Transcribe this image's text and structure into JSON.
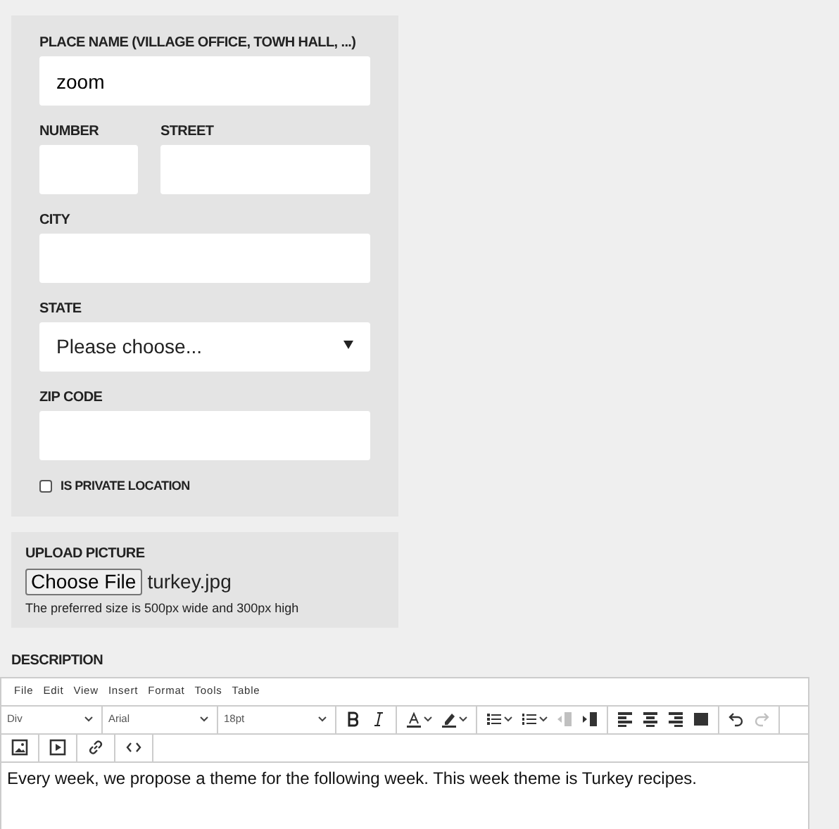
{
  "location": {
    "place_name": {
      "label": "PLACE NAME (VILLAGE OFFICE, TOWH HALL, ...)",
      "value": "zoom"
    },
    "number": {
      "label": "NUMBER"
    },
    "street": {
      "label": "STREET"
    },
    "city": {
      "label": "CITY"
    },
    "state": {
      "label": "STATE",
      "value": "Please choose..."
    },
    "zip": {
      "label": "ZIP CODE"
    },
    "private": {
      "label": "IS PRIVATE LOCATION",
      "checked": false
    }
  },
  "upload": {
    "label": "UPLOAD PICTURE",
    "button": "Choose File",
    "file": "turkey.jpg",
    "hint": "The preferred size is 500px wide and 300px high"
  },
  "description": {
    "label": "DESCRIPTION",
    "menu": [
      "File",
      "Edit",
      "View",
      "Insert",
      "Format",
      "Tools",
      "Table"
    ],
    "dropdowns": [
      "Div",
      "Arial",
      "18pt"
    ],
    "toolbar": [
      [
        {
          "kind": "bold",
          "disabled": false
        },
        {
          "kind": "italic",
          "disabled": false
        }
      ],
      [
        {
          "kind": "text-color",
          "disabled": false,
          "split": true
        },
        {
          "kind": "highlight",
          "disabled": false,
          "split": true
        }
      ],
      [
        {
          "kind": "bullets",
          "disabled": false,
          "split": true
        },
        {
          "kind": "numbers",
          "disabled": false,
          "split": true
        },
        {
          "kind": "outdent",
          "disabled": true
        },
        {
          "kind": "indent",
          "disabled": false
        }
      ],
      [
        {
          "kind": "align-left",
          "disabled": false
        },
        {
          "kind": "align-center",
          "disabled": false
        },
        {
          "kind": "align-right",
          "disabled": false
        },
        {
          "kind": "justify",
          "disabled": false
        }
      ],
      [
        {
          "kind": "undo",
          "disabled": false
        },
        {
          "kind": "redo",
          "disabled": true
        }
      ]
    ],
    "toolbar2": [
      {
        "kind": "image",
        "disabled": false
      },
      {
        "kind": "media",
        "disabled": false
      },
      {
        "kind": "link",
        "disabled": false
      },
      {
        "kind": "code",
        "disabled": false
      }
    ],
    "content": "Every week, we propose a theme for the following week. This week theme is Turkey recipes."
  }
}
